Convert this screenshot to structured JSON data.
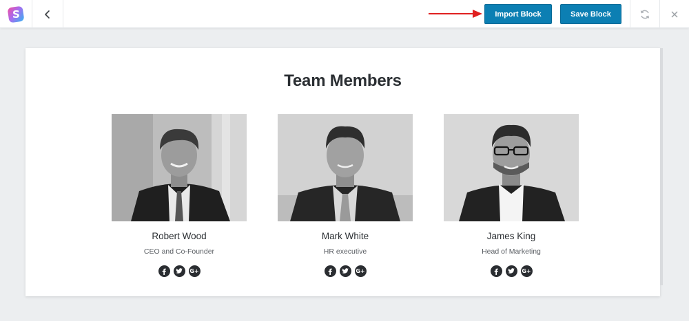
{
  "toolbar": {
    "logo_letter": "S",
    "import_label": "Import Block",
    "save_label": "Save Block",
    "accent_color": "#0c7fb3",
    "annotation_arrow_color": "#e02020"
  },
  "section": {
    "title": "Team Members"
  },
  "members": [
    {
      "name": "Robert Wood",
      "role": "CEO and Co-Founder"
    },
    {
      "name": "Mark White",
      "role": "HR executive"
    },
    {
      "name": "James King",
      "role": "Head of Marketing"
    }
  ],
  "social_icons": [
    "facebook-icon",
    "twitter-icon",
    "google-plus-icon"
  ],
  "social_labels": {
    "google_plus": "G+"
  }
}
